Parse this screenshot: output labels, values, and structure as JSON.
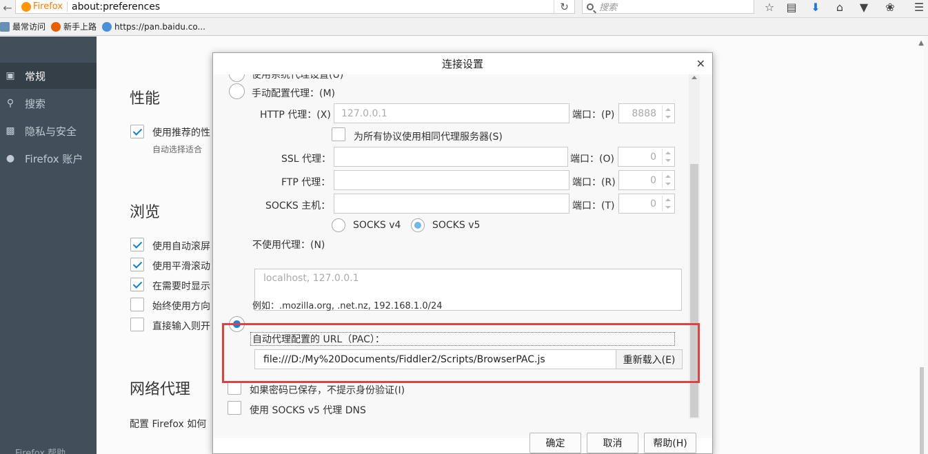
{
  "toolbar": {
    "brand": "Firefox",
    "url": "about:preferences",
    "search_placeholder": "搜索"
  },
  "bookmarks": [
    {
      "label": "最常访问",
      "icon": "star-folder-icon"
    },
    {
      "label": "新手上路",
      "icon": "firefox-icon"
    },
    {
      "label": "https://pan.baidu.co...",
      "icon": "baidu-cloud-icon"
    }
  ],
  "sidebar": {
    "items": [
      {
        "label": "常规",
        "icon": "general-icon",
        "active": true
      },
      {
        "label": "搜索",
        "icon": "search-icon",
        "active": false
      },
      {
        "label": "隐私与安全",
        "icon": "lock-icon",
        "active": false
      },
      {
        "label": "Firefox 账户",
        "icon": "account-icon",
        "active": false
      }
    ],
    "help": "Firefox 帮助"
  },
  "main": {
    "perf_title": "性能",
    "perf_option": "使用推荐的性",
    "perf_sub": "自动选择适合",
    "browse_title": "浏览",
    "browse_options": [
      {
        "label": "使用自动滚屏",
        "checked": true
      },
      {
        "label": "使用平滑滚动",
        "checked": true
      },
      {
        "label": "在需要时显示",
        "checked": true
      },
      {
        "label": "始终使用方向",
        "checked": false
      },
      {
        "label": "直接输入则开",
        "checked": false
      }
    ],
    "proxy_title": "网络代理",
    "proxy_desc": "配置 Firefox 如何"
  },
  "dialog": {
    "title": "连接设置",
    "system_proxy": "使用系统代理设置(U)",
    "manual_proxy": "手动配置代理：(M)",
    "http_label": "HTTP 代理：(X)",
    "http_value": "127.0.0.1",
    "port_http_label": "端口：(P)",
    "port_http_value": "8888",
    "same_proxy": "为所有协议使用相同代理服务器(S)",
    "ssl_label": "SSL 代理：",
    "port_ssl_label": "端口：(O)",
    "port_ssl_value": "0",
    "ftp_label": "FTP 代理：",
    "port_ftp_label": "端口：(R)",
    "port_ftp_value": "0",
    "socks_label": "SOCKS 主机：",
    "port_socks_label": "端口：(T)",
    "port_socks_value": "0",
    "socks_v4": "SOCKS v4",
    "socks_v5": "SOCKS v5",
    "no_proxy_label": "不使用代理：(N)",
    "no_proxy_value": "localhost, 127.0.0.1",
    "example": "例如：.mozilla.org, .net.nz, 192.168.1.0/24",
    "auto_pac": "自动代理配置的 URL（PAC）：",
    "pac_url": "file:///D:/My%20Documents/Fiddler2/Scripts/BrowserPAC.js",
    "reload": "重新载入(E)",
    "no_auth_prompt": "如果密码已保存，不提示身份验证(I)",
    "socks_dns": "使用 SOCKS v5 代理 DNS",
    "ok": "确定",
    "cancel": "取消",
    "help": "帮助(H)"
  },
  "colors": {
    "sidebar_bg": "#424f5a",
    "highlight": "#e04040",
    "radio_accent": "#0b84e5"
  }
}
